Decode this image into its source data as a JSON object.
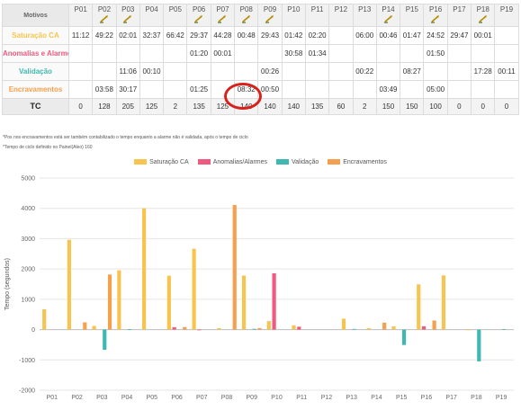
{
  "table": {
    "corner_label": "Motivos",
    "columns": [
      "P01",
      "P02",
      "P03",
      "P04",
      "P05",
      "P06",
      "P07",
      "P08",
      "P09",
      "P10",
      "P11",
      "P12",
      "P13",
      "P14",
      "P15",
      "P16",
      "P17",
      "P18",
      "P19"
    ],
    "columns_with_icon": [
      false,
      true,
      true,
      false,
      false,
      true,
      true,
      true,
      true,
      false,
      false,
      false,
      false,
      true,
      false,
      true,
      false,
      true,
      false
    ],
    "rows": [
      {
        "label": "Saturação CA",
        "color": "#f7c44f",
        "cells": [
          "11:12",
          "49:22",
          "02:01",
          "32:37",
          "66:42",
          "29:37",
          "44:28",
          "00:48",
          "29:43",
          "01:42",
          "02:20",
          "",
          "06:00",
          "00:46",
          "01:47",
          "24:52",
          "29:47",
          "00:01",
          ""
        ]
      },
      {
        "label": "Anomalias e Alarmes",
        "color": "#f05a7e",
        "cells": [
          "",
          "",
          "",
          "",
          "",
          "01:20",
          "00:01",
          "",
          "",
          "30:58",
          "01:34",
          "",
          "",
          "",
          "",
          "01:50",
          "",
          "",
          ""
        ]
      },
      {
        "label": "Validação",
        "color": "#3fb8b1",
        "cells": [
          "",
          "",
          "11:06",
          "00:10",
          "",
          "",
          "",
          "",
          "00:26",
          "",
          "",
          "",
          "00:22",
          "",
          "08:27",
          "",
          "",
          "17:28",
          "00:11"
        ]
      },
      {
        "label": "Encravamentos",
        "color": "#f6a04d",
        "cells": [
          "",
          "03:58",
          "30:17",
          "",
          "",
          "01:25",
          "",
          "08:32",
          "00:50",
          "",
          "",
          "",
          "",
          "03:49",
          "",
          "05:00",
          "",
          "",
          ""
        ]
      }
    ],
    "tc": {
      "label": "TC",
      "cells": [
        "0",
        "128",
        "205",
        "125",
        "2",
        "135",
        "125",
        "140",
        "140",
        "140",
        "135",
        "60",
        "2",
        "150",
        "150",
        "100",
        "0",
        "0",
        "0"
      ]
    }
  },
  "notes": [
    "*Pos nos encravamentos está ser também contabilizado o tempo enquanto a alarme não é validada, após o tempo de ciclo",
    "*Tempo de ciclo definido no Painel(Aleo) 160"
  ],
  "colors": {
    "highlight": "#d9211c",
    "grid": "#e6e6e6",
    "zero_line": "#bdbdbd"
  },
  "chart_data": {
    "type": "bar",
    "categories": [
      "P01",
      "P02",
      "P03",
      "P04",
      "P05",
      "P06",
      "P07",
      "P08",
      "P09",
      "P10",
      "P11",
      "P12",
      "P13",
      "P14",
      "P15",
      "P16",
      "P17",
      "P18",
      "P19"
    ],
    "series": [
      {
        "name": "Saturação CA",
        "color": "#f7c44f",
        "values": [
          672,
          2962,
          121,
          1957,
          4002,
          1777,
          2668,
          48,
          1783,
          280,
          140,
          0,
          360,
          46,
          107,
          1492,
          1787,
          1,
          0
        ]
      },
      {
        "name": "Anomalias/Alarmes",
        "color": "#f05a7e",
        "values": [
          0,
          0,
          0,
          0,
          0,
          80,
          1,
          0,
          0,
          1858,
          94,
          0,
          0,
          0,
          0,
          110,
          0,
          0,
          0
        ]
      },
      {
        "name": "Validação",
        "color": "#3fb8b1",
        "values": [
          0,
          0,
          -666,
          10,
          0,
          0,
          0,
          0,
          26,
          0,
          0,
          0,
          22,
          0,
          -507,
          0,
          0,
          -1048,
          11
        ]
      },
      {
        "name": "Encravamentos",
        "color": "#f6a04d",
        "values": [
          0,
          238,
          1817,
          0,
          0,
          85,
          0,
          4112,
          50,
          0,
          0,
          0,
          0,
          229,
          0,
          300,
          0,
          0,
          0
        ]
      }
    ],
    "ylim": [
      -2000,
      5000
    ],
    "yticks": [
      -2000,
      -1000,
      0,
      1000,
      2000,
      3000,
      4000,
      5000
    ],
    "ylabel": "Tempo (segundos)",
    "grid": true,
    "legend_position": "top"
  }
}
